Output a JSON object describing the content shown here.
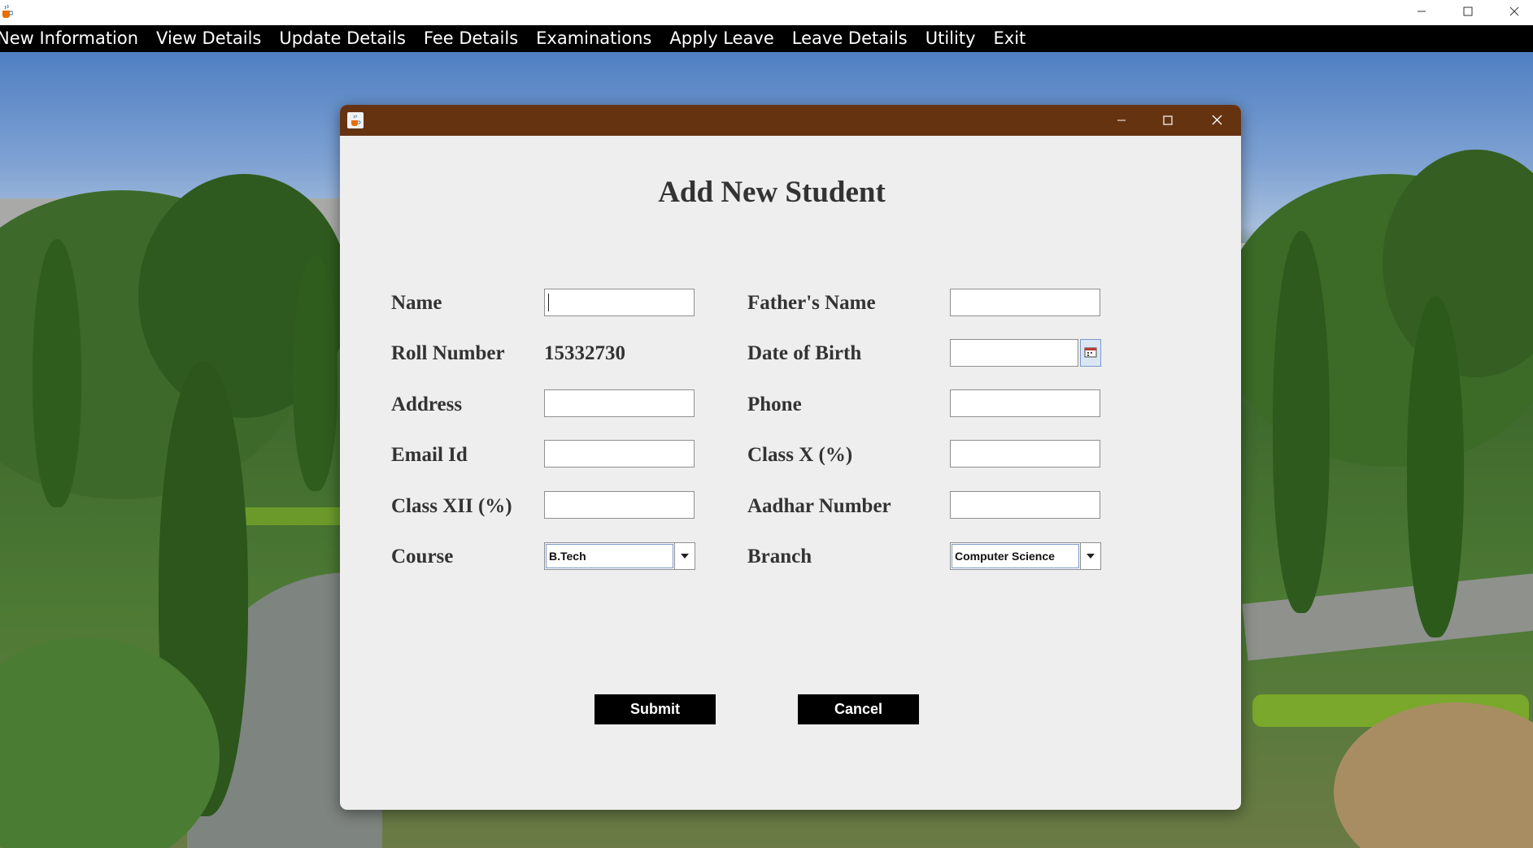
{
  "menubar": {
    "items": [
      "New Information",
      "View Details",
      "Update Details",
      "Fee Details",
      "Examinations",
      "Apply Leave",
      "Leave Details",
      "Utility",
      "Exit"
    ]
  },
  "dialog": {
    "heading": "Add New Student",
    "labels": {
      "name": "Name",
      "roll_number": "Roll Number",
      "address": "Address",
      "email": "Email Id",
      "class_xii": "Class XII (%)",
      "course": "Course",
      "fathers_name": "Father's Name",
      "dob": "Date of Birth",
      "phone": "Phone",
      "class_x": "Class X (%)",
      "aadhar": "Aadhar Number",
      "branch": "Branch"
    },
    "values": {
      "name": "",
      "roll_number": "15332730",
      "address": "",
      "email": "",
      "class_xii": "",
      "fathers_name": "",
      "dob": "",
      "phone": "",
      "class_x": "",
      "aadhar": ""
    },
    "course_selected": "B.Tech",
    "branch_selected": "Computer Science",
    "buttons": {
      "submit": "Submit",
      "cancel": "Cancel"
    }
  },
  "colors": {
    "menubar_bg": "#000000",
    "menubar_text": "#ffffff",
    "dialog_titlebar": "#663311",
    "dialog_bg": "#eeeeee",
    "label_text": "#333333",
    "button_bg": "#000000",
    "button_text": "#ffffff"
  },
  "icons": {
    "app": "java-cup-icon",
    "calendar": "calendar-icon",
    "dropdown": "chevron-down-icon"
  }
}
